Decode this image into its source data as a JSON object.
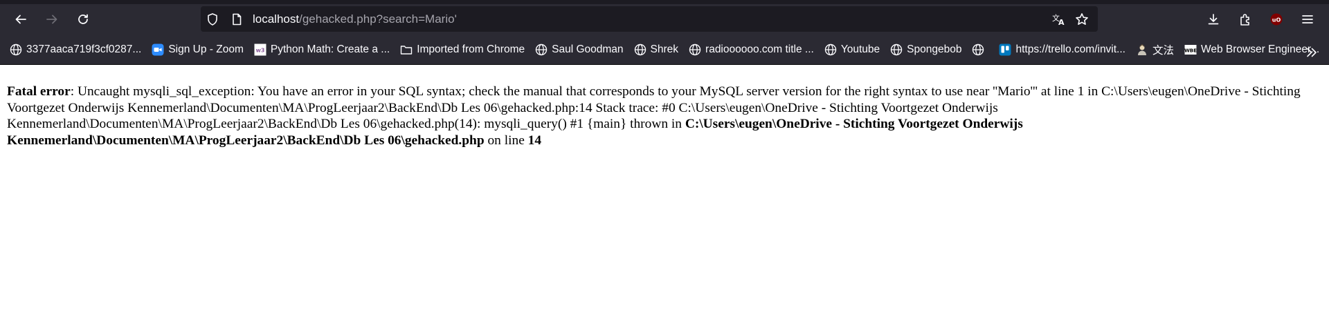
{
  "browser": {
    "url": {
      "host": "localhost",
      "path": "/gehacked.php?search=Mario'"
    },
    "bookmarks": [
      {
        "label": "3377aaca719f3cf0287...",
        "icon": "globe-icon"
      },
      {
        "label": "Sign Up - Zoom",
        "icon": "zoom-icon"
      },
      {
        "label": "Python Math: Create a ...",
        "icon": "w3schools-icon"
      },
      {
        "label": "Imported from Chrome",
        "icon": "folder-icon"
      },
      {
        "label": "Saul Goodman",
        "icon": "globe-icon"
      },
      {
        "label": "Shrek",
        "icon": "globe-icon"
      },
      {
        "label": "radioooooo.com title ...",
        "icon": "globe-icon"
      },
      {
        "label": "Youtube",
        "icon": "globe-icon"
      },
      {
        "label": "Spongebob",
        "icon": "globe-icon"
      },
      {
        "label": "",
        "icon": "globe-icon"
      },
      {
        "label": "https://trello.com/invit...",
        "icon": "trello-icon"
      },
      {
        "label": "文法",
        "icon": "character-icon"
      },
      {
        "label": "Web Browser Engineer...",
        "icon": "wbe-icon"
      }
    ]
  },
  "error": {
    "label": "Fatal error",
    "message": ": Uncaught mysqli_sql_exception: You have an error in your SQL syntax; check the manual that corresponds to your MySQL server version for the right syntax to use near ''Mario''' at line 1 in C:\\Users\\eugen\\OneDrive - Stichting Voortgezet Onderwijs Kennemerland\\Documenten\\MA\\ProgLeerjaar2\\BackEnd\\Db Les 06\\gehacked.php:14 Stack trace: #0 C:\\Users\\eugen\\OneDrive - Stichting Voortgezet Onderwijs Kennemerland\\Documenten\\MA\\ProgLeerjaar2\\BackEnd\\Db Les 06\\gehacked.php(14): mysqli_query() #1 {main} thrown in ",
    "file_path": "C:\\Users\\eugen\\OneDrive - Stichting Voortgezet Onderwijs Kennemerland\\Documenten\\MA\\ProgLeerjaar2\\BackEnd\\Db Les 06\\gehacked.php",
    "on_line_text": " on line ",
    "line_number": "14"
  }
}
